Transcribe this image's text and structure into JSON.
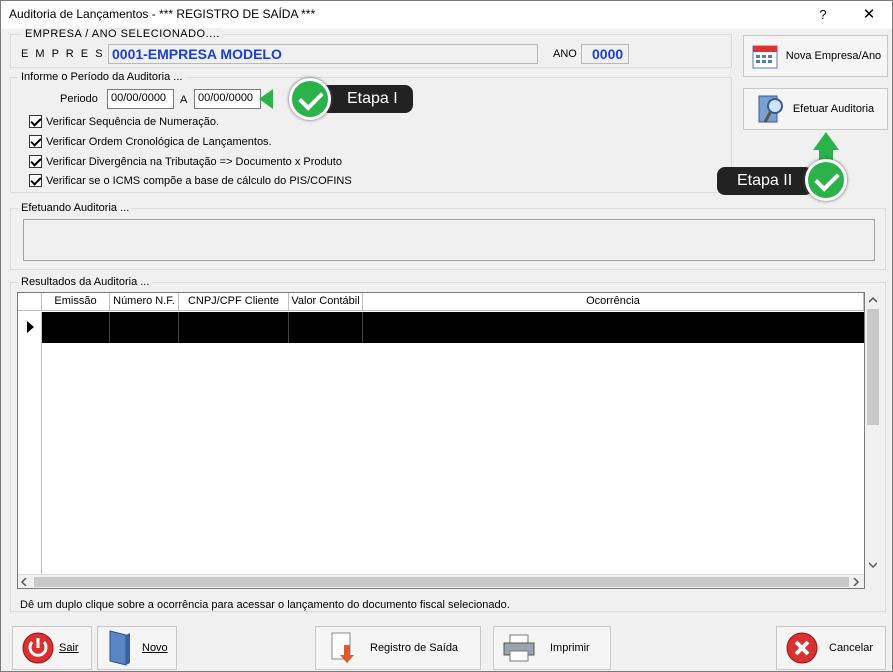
{
  "window": {
    "title": "Auditoria de Lançamentos - *** REGISTRO DE SAÍDA ***",
    "help": "?",
    "close": "✕"
  },
  "empresa": {
    "group_label": "EMPRESA  /  ANO  SELECIONADO....",
    "label": "E M P R E S A",
    "value": "0001-EMPRESA MODELO",
    "ano_label": "ANO",
    "ano_value": "0000"
  },
  "periodo": {
    "group_label": "Informe o Período da Auditoria  ...",
    "label": "Periodo",
    "start": "00/00/0000",
    "sep": "A",
    "end": "00/00/0000"
  },
  "checks": [
    {
      "label": "Verificar Sequência de Numeração.",
      "checked": true
    },
    {
      "label": "Verificar Ordem Cronológica de Lançamentos.",
      "checked": true
    },
    {
      "label": "Verificar Divergência na Tributação => Documento x Produto",
      "checked": true
    },
    {
      "label": "Verificar se o ICMS compõe a base de cálculo do PIS/COFINS",
      "checked": true
    }
  ],
  "side_buttons": {
    "nova": "Nova Empresa/Ano",
    "efetuar": "Efetuar Auditoria"
  },
  "callouts": {
    "etapa1": "Etapa I",
    "etapa2": "Etapa II"
  },
  "efetuando": {
    "label": "Efetuando Auditoria ..."
  },
  "resultados": {
    "label": "Resultados da Auditoria ...",
    "columns": [
      "Emissão",
      "Número N.F.",
      "CNPJ/CPF Cliente",
      "Valor Contábil",
      "Ocorrência"
    ],
    "hint": "Dê um duplo clique sobre a ocorrência para acessar o lançamento do documento fiscal selecionado."
  },
  "bottom_buttons": {
    "sair": "Sair",
    "novo": "Novo",
    "registro": "Registro de Saída",
    "imprimir": "Imprimir",
    "cancelar": "Cancelar"
  },
  "colors": {
    "accent_blue": "#1a3fd6",
    "callout_bg": "#222222",
    "check_green": "#2bb34b"
  }
}
